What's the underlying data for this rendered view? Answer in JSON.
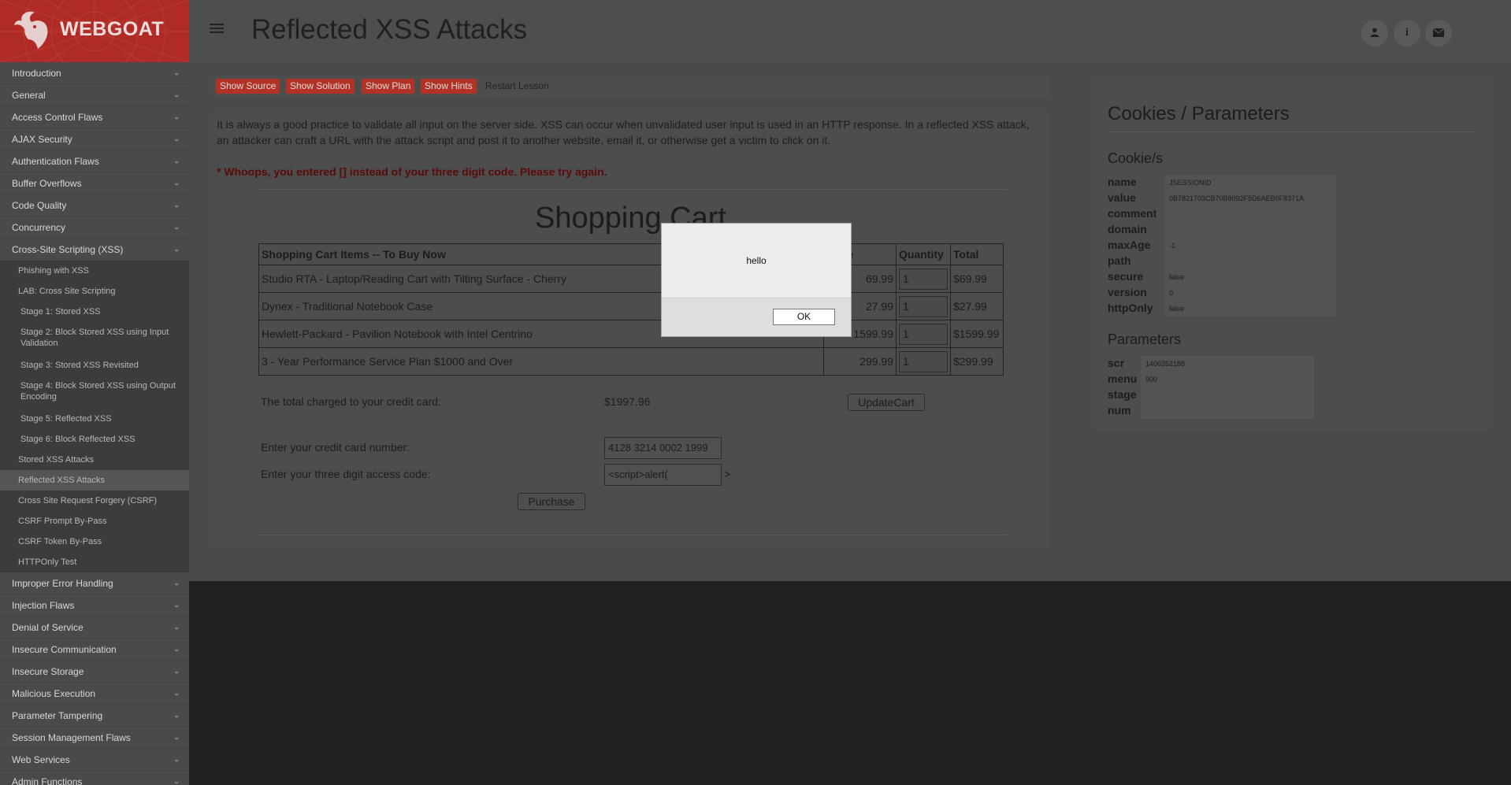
{
  "brand": {
    "name": "WEBGOAT"
  },
  "header": {
    "title": "Reflected XSS Attacks"
  },
  "sidebar": {
    "categories_top": [
      {
        "label": "Introduction"
      },
      {
        "label": "General"
      },
      {
        "label": "Access Control Flaws"
      },
      {
        "label": "AJAX Security"
      },
      {
        "label": "Authentication Flaws"
      },
      {
        "label": "Buffer Overflows"
      },
      {
        "label": "Code Quality"
      },
      {
        "label": "Concurrency"
      },
      {
        "label": "Cross-Site Scripting (XSS)"
      }
    ],
    "xss_items": [
      {
        "label": "Phishing with XSS"
      },
      {
        "label": "LAB: Cross Site Scripting"
      },
      {
        "label": "Stage 1: Stored XSS"
      },
      {
        "label": "Stage 2: Block Stored XSS using Input Validation"
      },
      {
        "label": "Stage 3: Stored XSS Revisited"
      },
      {
        "label": "Stage 4: Block Stored XSS using Output Encoding"
      },
      {
        "label": "Stage 5: Reflected XSS"
      },
      {
        "label": "Stage 6: Block Reflected XSS"
      },
      {
        "label": "Stored XSS Attacks"
      },
      {
        "label": "Reflected XSS Attacks"
      },
      {
        "label": "Cross Site Request Forgery (CSRF)"
      },
      {
        "label": "CSRF Prompt By-Pass"
      },
      {
        "label": "CSRF Token By-Pass"
      },
      {
        "label": "HTTPOnly Test"
      }
    ],
    "categories_bottom": [
      {
        "label": "Improper Error Handling"
      },
      {
        "label": "Injection Flaws"
      },
      {
        "label": "Denial of Service"
      },
      {
        "label": "Insecure Communication"
      },
      {
        "label": "Insecure Storage"
      },
      {
        "label": "Malicious Execution"
      },
      {
        "label": "Parameter Tampering"
      },
      {
        "label": "Session Management Flaws"
      },
      {
        "label": "Web Services"
      },
      {
        "label": "Admin Functions"
      }
    ]
  },
  "toolbar": {
    "show_source": "Show Source",
    "show_solution": "Show Solution",
    "show_plan": "Show Plan",
    "show_hints": "Show Hints",
    "restart": "Restart Lesson"
  },
  "lesson": {
    "intro": "It is always a good practice to validate all input on the server side. XSS can occur when unvalidated user input is used in an HTTP response. In a reflected XSS attack, an attacker can craft a URL with the attack script and post it to another website, email it, or otherwise get a victim to click on it.",
    "error": "* Whoops, you entered [] instead of your three digit code. Please try again.",
    "cart_title": "Shopping Cart",
    "table_headers": {
      "items": "Shopping Cart Items -- To Buy Now",
      "price": "Price",
      "quantity": "Quantity",
      "total": "Total"
    },
    "rows": [
      {
        "item": "Studio RTA - Laptop/Reading Cart with Tilting Surface - Cherry",
        "price": "69.99",
        "qty": "1",
        "total": "$69.99"
      },
      {
        "item": "Dynex - Traditional Notebook Case",
        "price": "27.99",
        "qty": "1",
        "total": "$27.99"
      },
      {
        "item": "Hewlett-Packard - Pavilion Notebook with Intel Centrino",
        "price": "1599.99",
        "qty": "1",
        "total": "$1599.99"
      },
      {
        "item": "3 - Year Performance Service Plan $1000 and Over",
        "price": "299.99",
        "qty": "1",
        "total": "$299.99"
      }
    ],
    "total_label": "The total charged to your credit card:",
    "total_value": "$1997.96",
    "update_button": "UpdateCart",
    "cc_label": "Enter your credit card number:",
    "cc_value": "4128 3214 0002 1999",
    "code_label": "Enter your three digit access code:",
    "code_value": "<script>alert(",
    "code_trailing": ">",
    "purchase_button": "Purchase"
  },
  "params_panel": {
    "title": "Cookies / Parameters",
    "cookies_heading": "Cookie/s",
    "cookies": [
      {
        "k": "name",
        "v": "JSESSIONID"
      },
      {
        "k": "value",
        "v": "0B7821703CB70B8092F5D6AEB0F8371A"
      },
      {
        "k": "comment",
        "v": ""
      },
      {
        "k": "domain",
        "v": ""
      },
      {
        "k": "maxAge",
        "v": "-1"
      },
      {
        "k": "path",
        "v": ""
      },
      {
        "k": "secure",
        "v": "false"
      },
      {
        "k": "version",
        "v": "0"
      },
      {
        "k": "httpOnly",
        "v": "false"
      }
    ],
    "params_heading": "Parameters",
    "params": [
      {
        "k": "scr",
        "v": "1406352188"
      },
      {
        "k": "menu",
        "v": "900"
      },
      {
        "k": "stage",
        "v": ""
      },
      {
        "k": "num",
        "v": ""
      }
    ]
  },
  "alert": {
    "message": "hello",
    "ok": "OK"
  },
  "colors": {
    "brand": "#b02b26",
    "button_red": "#b33226",
    "sidebar": "#4a4a4a"
  }
}
